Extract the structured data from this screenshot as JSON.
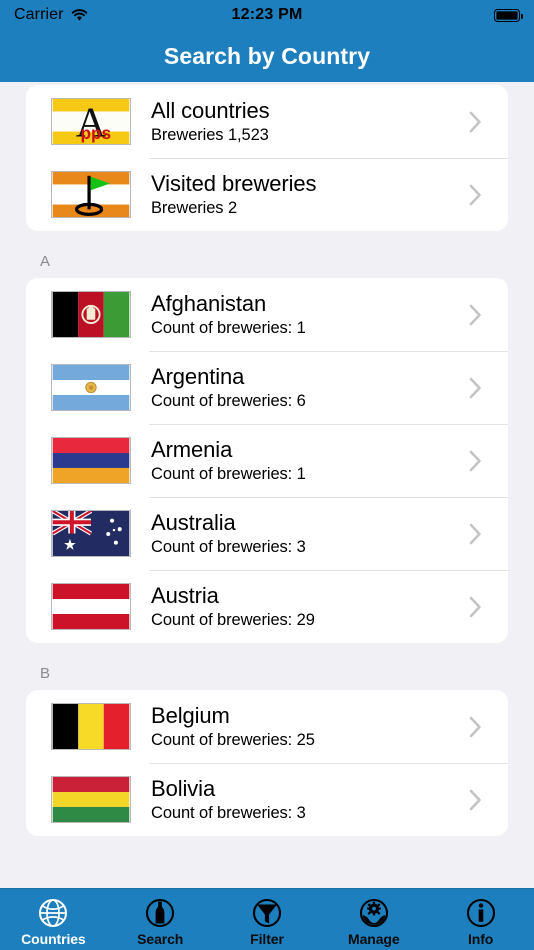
{
  "statusbar": {
    "carrier": "Carrier",
    "time": "12:23 PM",
    "wifi_icon": "wifi-icon",
    "battery_icon": "battery-full-icon"
  },
  "navbar": {
    "title": "Search by Country"
  },
  "colors": {
    "brand_blue": "#1d7fbe",
    "page_background": "#f1f1f5",
    "card_background": "#ffffff",
    "section_header_text": "#8a8a8e",
    "chevron": "#c4c4c8"
  },
  "sections": [
    {
      "header": "",
      "rows": [
        {
          "title": "All countries",
          "subtitle": "Breweries 1,523",
          "flag": "apps-logo-flag",
          "accessory": "chevron-right-icon"
        },
        {
          "title": "Visited breweries",
          "subtitle": "Breweries 2",
          "flag": "golf-flag",
          "accessory": "chevron-right-icon"
        }
      ]
    },
    {
      "header": "A",
      "rows": [
        {
          "title": "Afghanistan",
          "subtitle": "Count of breweries: 1",
          "flag": "flag-afghanistan",
          "accessory": "chevron-right-icon"
        },
        {
          "title": "Argentina",
          "subtitle": "Count of breweries: 6",
          "flag": "flag-argentina",
          "accessory": "chevron-right-icon"
        },
        {
          "title": "Armenia",
          "subtitle": "Count of breweries: 1",
          "flag": "flag-armenia",
          "accessory": "chevron-right-icon"
        },
        {
          "title": "Australia",
          "subtitle": "Count of breweries: 3",
          "flag": "flag-australia",
          "accessory": "chevron-right-icon"
        },
        {
          "title": "Austria",
          "subtitle": "Count of breweries: 29",
          "flag": "flag-austria",
          "accessory": "chevron-right-icon"
        }
      ]
    },
    {
      "header": "B",
      "rows": [
        {
          "title": "Belgium",
          "subtitle": "Count of breweries: 25",
          "flag": "flag-belgium",
          "accessory": "chevron-right-icon"
        },
        {
          "title": "Bolivia",
          "subtitle": "Count of breweries: 3",
          "flag": "flag-bolivia",
          "accessory": "chevron-right-icon"
        }
      ]
    }
  ],
  "tabbar": {
    "items": [
      {
        "label": "Countries",
        "icon": "globe-icon",
        "selected": true
      },
      {
        "label": "Search",
        "icon": "bottle-icon",
        "selected": false
      },
      {
        "label": "Filter",
        "icon": "funnel-icon",
        "selected": false
      },
      {
        "label": "Manage",
        "icon": "gear-hands-icon",
        "selected": false
      },
      {
        "label": "Info",
        "icon": "info-icon",
        "selected": false
      }
    ]
  }
}
